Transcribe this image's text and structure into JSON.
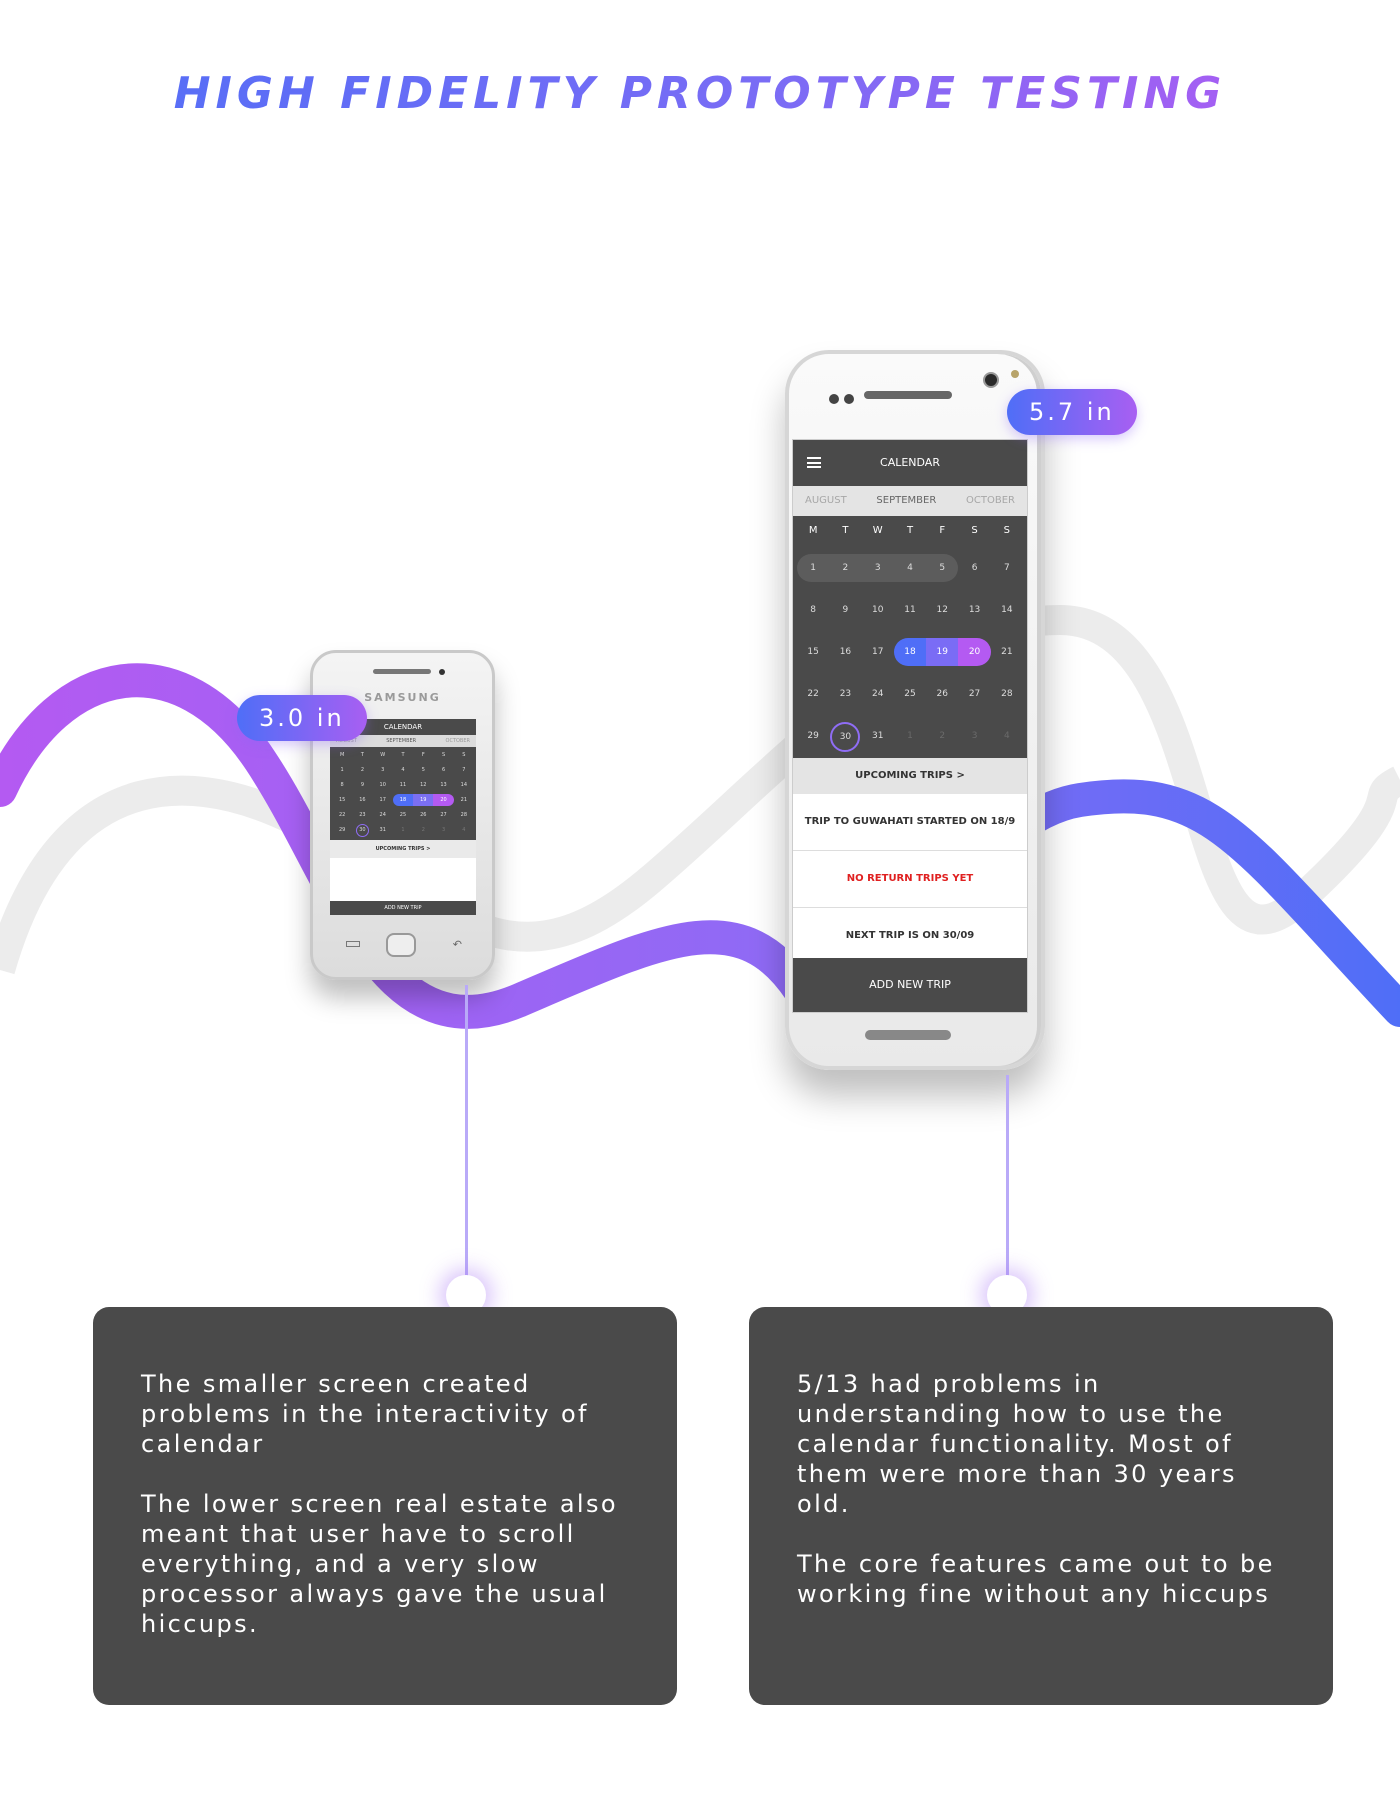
{
  "title": "HIGH FIDELITY PROTOTYPE TESTING",
  "badges": {
    "small": "3.0 in",
    "large": "5.7 in"
  },
  "small_phone": {
    "brand": "SAMSUNG",
    "screen_title": "CALENDAR",
    "months": [
      "AUGUST",
      "SEPTEMBER",
      "OCTOBER"
    ],
    "upcoming": "UPCOMING TRIPS >",
    "add": "ADD NEW TRIP"
  },
  "large_phone": {
    "screen_title": "CALENDAR",
    "months": [
      "AUGUST",
      "SEPTEMBER",
      "OCTOBER"
    ],
    "weekdays": [
      "M",
      "T",
      "W",
      "T",
      "F",
      "S",
      "S"
    ],
    "upcoming": "UPCOMING TRIPS",
    "upcoming_chevron": ">",
    "trips": [
      "TRIP TO GUWAHATI STARTED ON 18/9",
      "NO RETURN TRIPS YET",
      "NEXT TRIP IS ON 30/09"
    ],
    "add": "ADD NEW TRIP"
  },
  "calendar_days": [
    [
      "1",
      "2",
      "3",
      "4",
      "5",
      "6",
      "7"
    ],
    [
      "8",
      "9",
      "10",
      "11",
      "12",
      "13",
      "14"
    ],
    [
      "15",
      "16",
      "17",
      "18",
      "19",
      "20",
      "21"
    ],
    [
      "22",
      "23",
      "24",
      "25",
      "26",
      "27",
      "28"
    ],
    [
      "29",
      "30",
      "31",
      "1",
      "2",
      "3",
      "4"
    ]
  ],
  "cards": [
    {
      "p1": "The smaller screen created problems in the interactivity of calendar",
      "p2": "The lower screen real estate also meant that user have to scroll everything, and a very slow processor always gave the usual hiccups."
    },
    {
      "p1": "5/13 had problems in understanding how to use the calendar functionality. Most of them were more than 30 years old.",
      "p2": "The core features came out to be working fine without any hiccups"
    }
  ],
  "colors": {
    "accent_blue": "#4f6ef7",
    "accent_purple": "#b45af2",
    "card_bg": "#4a4a4a",
    "alert_red": "#e02020"
  }
}
